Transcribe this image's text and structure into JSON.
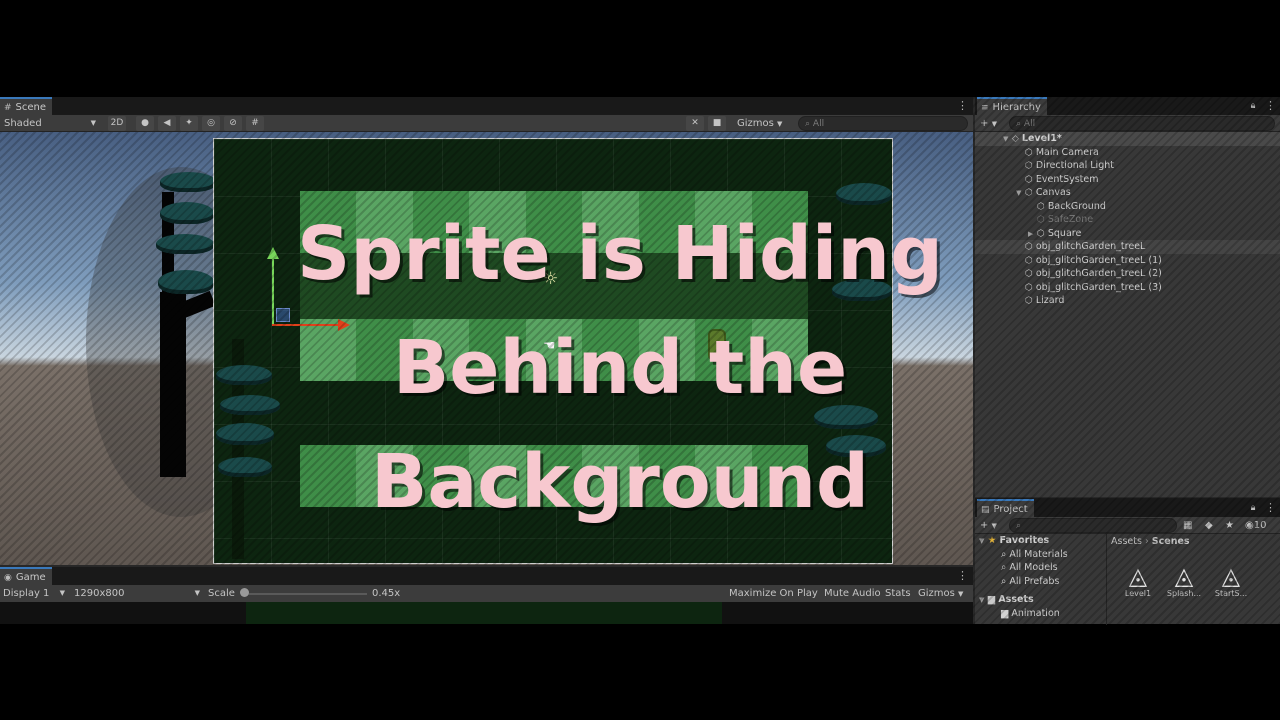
{
  "overlay": {
    "line1": "Sprite is Hiding",
    "line2": "Behind the",
    "line3": "Background"
  },
  "scene": {
    "tab_label": "Scene",
    "shading_mode": "Shaded",
    "mode_2d": "2D",
    "gizmos_label": "Gizmos",
    "search_placeholder": "All"
  },
  "game": {
    "tab_label": "Game",
    "display": "Display 1",
    "resolution": "1290x800",
    "scale_label": "Scale",
    "scale_value": "0.45x",
    "maximize_on_play": "Maximize On Play",
    "mute_audio": "Mute Audio",
    "stats": "Stats",
    "gizmos_label": "Gizmos"
  },
  "hierarchy": {
    "tab_label": "Hierarchy",
    "search_placeholder": "All",
    "items": [
      {
        "label": "Level1*",
        "depth": 0,
        "type": "scene",
        "expanded": true
      },
      {
        "label": "Main Camera",
        "depth": 1,
        "type": "object"
      },
      {
        "label": "Directional Light",
        "depth": 1,
        "type": "object"
      },
      {
        "label": "EventSystem",
        "depth": 1,
        "type": "object"
      },
      {
        "label": "Canvas",
        "depth": 1,
        "type": "object",
        "expanded": true
      },
      {
        "label": "BackGround",
        "depth": 2,
        "type": "object"
      },
      {
        "label": "SafeZone",
        "depth": 2,
        "type": "object",
        "disabled": true
      },
      {
        "label": "Square",
        "depth": 2,
        "type": "object",
        "collapsed": true
      },
      {
        "label": "obj_glitchGarden_treeL",
        "depth": 1,
        "type": "object",
        "selected": true
      },
      {
        "label": "obj_glitchGarden_treeL (1)",
        "depth": 1,
        "type": "object"
      },
      {
        "label": "obj_glitchGarden_treeL (2)",
        "depth": 1,
        "type": "object"
      },
      {
        "label": "obj_glitchGarden_treeL (3)",
        "depth": 1,
        "type": "object"
      },
      {
        "label": "Lizard",
        "depth": 1,
        "type": "object"
      }
    ]
  },
  "project": {
    "tab_label": "Project",
    "hidden_count": "10",
    "favorites_label": "Favorites",
    "favorites": [
      "All Materials",
      "All Models",
      "All Prefabs"
    ],
    "assets_label": "Assets",
    "asset_folders": [
      "Animation"
    ],
    "breadcrumb": [
      "Assets",
      "Scenes"
    ],
    "scene_assets": [
      "Level1",
      "Splash...",
      "StartS..."
    ]
  },
  "colors": {
    "title_pink": "#f7c8cf",
    "grass_light": "#4f9a55",
    "grass_dark": "#2f7a3a",
    "editor_panel": "#383838"
  },
  "icons": {
    "scene_tab": "hash-icon",
    "hierarchy_object": "cube-icon",
    "scene_asset": "unity-logo-icon"
  }
}
